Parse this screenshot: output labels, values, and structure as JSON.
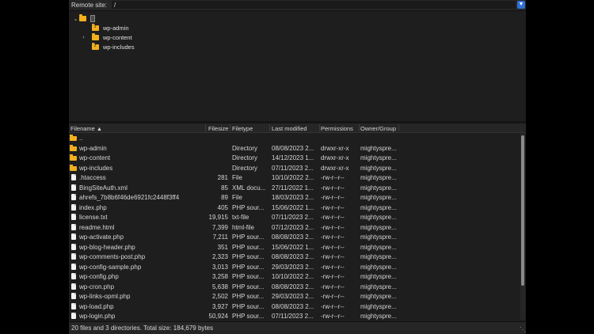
{
  "remote": {
    "label": "Remote site:",
    "path": "/"
  },
  "tree": {
    "root_label": "",
    "items": [
      {
        "label": "wp-admin"
      },
      {
        "label": "wp-content"
      },
      {
        "label": "wp-includes"
      }
    ]
  },
  "list": {
    "columns": {
      "name": "Filename",
      "size": "Filesize",
      "type": "Filetype",
      "modified": "Last modified",
      "perms": "Permissions",
      "owner": "Owner/Group"
    },
    "rows": [
      {
        "name": "..",
        "size": "",
        "type": "",
        "modified": "",
        "perms": "",
        "owner": "",
        "kind": "folder"
      },
      {
        "name": "wp-admin",
        "size": "",
        "type": "Directory",
        "modified": "08/08/2023 2...",
        "perms": "drwxr-xr-x",
        "owner": "mightyspre...",
        "kind": "folder"
      },
      {
        "name": "wp-content",
        "size": "",
        "type": "Directory",
        "modified": "14/12/2023 1...",
        "perms": "drwxr-xr-x",
        "owner": "mightyspre...",
        "kind": "folder"
      },
      {
        "name": "wp-includes",
        "size": "",
        "type": "Directory",
        "modified": "07/11/2023 2...",
        "perms": "drwxr-xr-x",
        "owner": "mightyspre...",
        "kind": "folder"
      },
      {
        "name": ".htaccess",
        "size": "281",
        "type": "File",
        "modified": "10/10/2022 2...",
        "perms": "-rw-r--r--",
        "owner": "mightyspre...",
        "kind": "file"
      },
      {
        "name": "BingSiteAuth.xml",
        "size": "85",
        "type": "XML docu...",
        "modified": "27/11/2022 1...",
        "perms": "-rw-r--r--",
        "owner": "mightyspre...",
        "kind": "file"
      },
      {
        "name": "ahrefs_7b8b6f46de6921fc2448f3ff4",
        "size": "89",
        "type": "File",
        "modified": "18/03/2023 2...",
        "perms": "-rw-r--r--",
        "owner": "mightyspre...",
        "kind": "file"
      },
      {
        "name": "index.php",
        "size": "405",
        "type": "PHP sour...",
        "modified": "15/06/2022 1...",
        "perms": "-rw-r--r--",
        "owner": "mightyspre...",
        "kind": "file"
      },
      {
        "name": "license.txt",
        "size": "19,915",
        "type": "txt-file",
        "modified": "07/11/2023 2...",
        "perms": "-rw-r--r--",
        "owner": "mightyspre...",
        "kind": "file"
      },
      {
        "name": "readme.html",
        "size": "7,399",
        "type": "html-file",
        "modified": "07/12/2023 2...",
        "perms": "-rw-r--r--",
        "owner": "mightyspre...",
        "kind": "file"
      },
      {
        "name": "wp-activate.php",
        "size": "7,211",
        "type": "PHP sour...",
        "modified": "08/08/2023 2...",
        "perms": "-rw-r--r--",
        "owner": "mightyspre...",
        "kind": "file"
      },
      {
        "name": "wp-blog-header.php",
        "size": "351",
        "type": "PHP sour...",
        "modified": "15/06/2022 1...",
        "perms": "-rw-r--r--",
        "owner": "mightyspre...",
        "kind": "file"
      },
      {
        "name": "wp-comments-post.php",
        "size": "2,323",
        "type": "PHP sour...",
        "modified": "08/08/2023 2...",
        "perms": "-rw-r--r--",
        "owner": "mightyspre...",
        "kind": "file"
      },
      {
        "name": "wp-config-sample.php",
        "size": "3,013",
        "type": "PHP sour...",
        "modified": "29/03/2023 2...",
        "perms": "-rw-r--r--",
        "owner": "mightyspre...",
        "kind": "file"
      },
      {
        "name": "wp-config.php",
        "size": "3,258",
        "type": "PHP sour...",
        "modified": "10/10/2022 2...",
        "perms": "-rw-r--r--",
        "owner": "mightyspre...",
        "kind": "file"
      },
      {
        "name": "wp-cron.php",
        "size": "5,638",
        "type": "PHP sour...",
        "modified": "08/08/2023 2...",
        "perms": "-rw-r--r--",
        "owner": "mightyspre...",
        "kind": "file"
      },
      {
        "name": "wp-links-opml.php",
        "size": "2,502",
        "type": "PHP sour...",
        "modified": "29/03/2023 2...",
        "perms": "-rw-r--r--",
        "owner": "mightyspre...",
        "kind": "file"
      },
      {
        "name": "wp-load.php",
        "size": "3,927",
        "type": "PHP sour...",
        "modified": "08/08/2023 2...",
        "perms": "-rw-r--r--",
        "owner": "mightyspre...",
        "kind": "file"
      },
      {
        "name": "wp-login.php",
        "size": "50,924",
        "type": "PHP sour...",
        "modified": "07/11/2023 2...",
        "perms": "-rw-r--r--",
        "owner": "mightyspre...",
        "kind": "file"
      }
    ]
  },
  "status": {
    "text": "20 files and 3 directories. Total size: 184,679 bytes"
  },
  "colors": {
    "accent": "#2f6fd6",
    "folder": "#f2b01e",
    "background": "#1e1e1e"
  }
}
